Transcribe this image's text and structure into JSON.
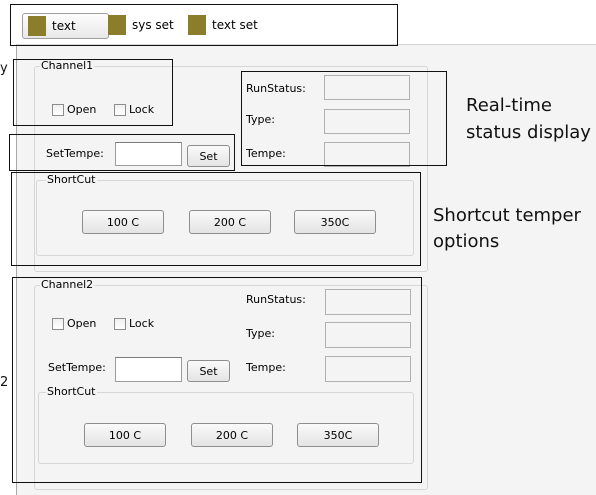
{
  "toolbar": {
    "items": [
      {
        "label": "text",
        "icon": "folder-icon",
        "active": true
      },
      {
        "label": "sys set",
        "icon": "folder-icon"
      },
      {
        "label": "text set",
        "icon": "folder-icon"
      }
    ]
  },
  "channel1": {
    "title": "Channel1",
    "open_label": "Open",
    "lock_label": "Lock",
    "settempe_label": "SetTempe:",
    "settempe_value": "",
    "set_button": "Set",
    "status": {
      "runstatus_label": "RunStatus:",
      "type_label": "Type:",
      "tempe_label": "Tempe:"
    },
    "shortcut": {
      "title": "ShortCut",
      "buttons": [
        "100 C",
        "200 C",
        "350C"
      ]
    }
  },
  "channel2": {
    "title": "Channel2",
    "open_label": "Open",
    "lock_label": "Lock",
    "settempe_label": "SetTempe:",
    "settempe_value": "",
    "set_button": "Set",
    "status": {
      "runstatus_label": "RunStatus:",
      "type_label": "Type:",
      "tempe_label": "Tempe:"
    },
    "shortcut": {
      "title": "ShortCut",
      "buttons": [
        "100 C",
        "200 C",
        "350C"
      ]
    }
  },
  "annotations": {
    "realtime_line1": "Real-time",
    "realtime_line2": "status display",
    "shortcut_line1": "Shortcut temper",
    "shortcut_line2": "options",
    "left_mark1": "y",
    "left_mark2": "2"
  },
  "colors": {
    "icon": "#8b7d2a",
    "panel_bg": "#f4f4f4"
  }
}
